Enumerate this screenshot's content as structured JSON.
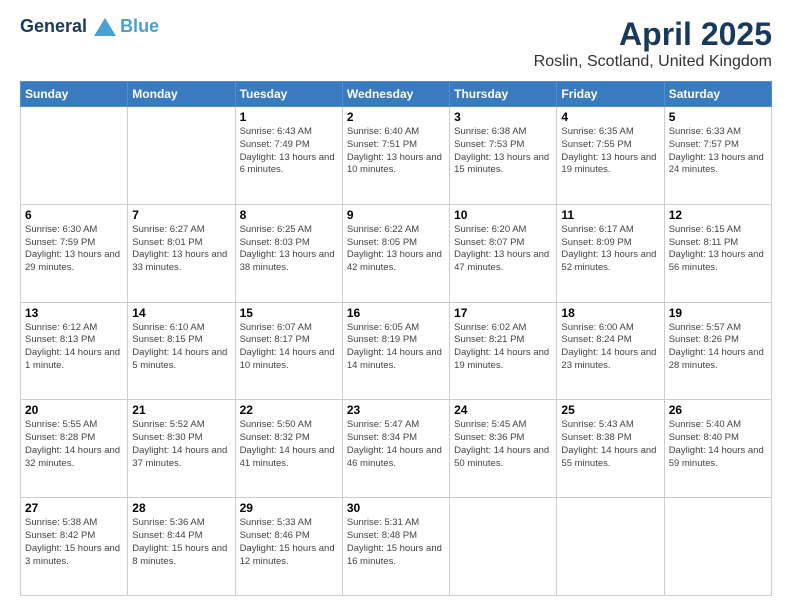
{
  "header": {
    "logo_line1": "General",
    "logo_line2": "Blue",
    "title": "April 2025",
    "subtitle": "Roslin, Scotland, United Kingdom"
  },
  "weekdays": [
    "Sunday",
    "Monday",
    "Tuesday",
    "Wednesday",
    "Thursday",
    "Friday",
    "Saturday"
  ],
  "weeks": [
    [
      {
        "day": "",
        "info": ""
      },
      {
        "day": "",
        "info": ""
      },
      {
        "day": "1",
        "info": "Sunrise: 6:43 AM\nSunset: 7:49 PM\nDaylight: 13 hours and 6 minutes."
      },
      {
        "day": "2",
        "info": "Sunrise: 6:40 AM\nSunset: 7:51 PM\nDaylight: 13 hours and 10 minutes."
      },
      {
        "day": "3",
        "info": "Sunrise: 6:38 AM\nSunset: 7:53 PM\nDaylight: 13 hours and 15 minutes."
      },
      {
        "day": "4",
        "info": "Sunrise: 6:35 AM\nSunset: 7:55 PM\nDaylight: 13 hours and 19 minutes."
      },
      {
        "day": "5",
        "info": "Sunrise: 6:33 AM\nSunset: 7:57 PM\nDaylight: 13 hours and 24 minutes."
      }
    ],
    [
      {
        "day": "6",
        "info": "Sunrise: 6:30 AM\nSunset: 7:59 PM\nDaylight: 13 hours and 29 minutes."
      },
      {
        "day": "7",
        "info": "Sunrise: 6:27 AM\nSunset: 8:01 PM\nDaylight: 13 hours and 33 minutes."
      },
      {
        "day": "8",
        "info": "Sunrise: 6:25 AM\nSunset: 8:03 PM\nDaylight: 13 hours and 38 minutes."
      },
      {
        "day": "9",
        "info": "Sunrise: 6:22 AM\nSunset: 8:05 PM\nDaylight: 13 hours and 42 minutes."
      },
      {
        "day": "10",
        "info": "Sunrise: 6:20 AM\nSunset: 8:07 PM\nDaylight: 13 hours and 47 minutes."
      },
      {
        "day": "11",
        "info": "Sunrise: 6:17 AM\nSunset: 8:09 PM\nDaylight: 13 hours and 52 minutes."
      },
      {
        "day": "12",
        "info": "Sunrise: 6:15 AM\nSunset: 8:11 PM\nDaylight: 13 hours and 56 minutes."
      }
    ],
    [
      {
        "day": "13",
        "info": "Sunrise: 6:12 AM\nSunset: 8:13 PM\nDaylight: 14 hours and 1 minute."
      },
      {
        "day": "14",
        "info": "Sunrise: 6:10 AM\nSunset: 8:15 PM\nDaylight: 14 hours and 5 minutes."
      },
      {
        "day": "15",
        "info": "Sunrise: 6:07 AM\nSunset: 8:17 PM\nDaylight: 14 hours and 10 minutes."
      },
      {
        "day": "16",
        "info": "Sunrise: 6:05 AM\nSunset: 8:19 PM\nDaylight: 14 hours and 14 minutes."
      },
      {
        "day": "17",
        "info": "Sunrise: 6:02 AM\nSunset: 8:21 PM\nDaylight: 14 hours and 19 minutes."
      },
      {
        "day": "18",
        "info": "Sunrise: 6:00 AM\nSunset: 8:24 PM\nDaylight: 14 hours and 23 minutes."
      },
      {
        "day": "19",
        "info": "Sunrise: 5:57 AM\nSunset: 8:26 PM\nDaylight: 14 hours and 28 minutes."
      }
    ],
    [
      {
        "day": "20",
        "info": "Sunrise: 5:55 AM\nSunset: 8:28 PM\nDaylight: 14 hours and 32 minutes."
      },
      {
        "day": "21",
        "info": "Sunrise: 5:52 AM\nSunset: 8:30 PM\nDaylight: 14 hours and 37 minutes."
      },
      {
        "day": "22",
        "info": "Sunrise: 5:50 AM\nSunset: 8:32 PM\nDaylight: 14 hours and 41 minutes."
      },
      {
        "day": "23",
        "info": "Sunrise: 5:47 AM\nSunset: 8:34 PM\nDaylight: 14 hours and 46 minutes."
      },
      {
        "day": "24",
        "info": "Sunrise: 5:45 AM\nSunset: 8:36 PM\nDaylight: 14 hours and 50 minutes."
      },
      {
        "day": "25",
        "info": "Sunrise: 5:43 AM\nSunset: 8:38 PM\nDaylight: 14 hours and 55 minutes."
      },
      {
        "day": "26",
        "info": "Sunrise: 5:40 AM\nSunset: 8:40 PM\nDaylight: 14 hours and 59 minutes."
      }
    ],
    [
      {
        "day": "27",
        "info": "Sunrise: 5:38 AM\nSunset: 8:42 PM\nDaylight: 15 hours and 3 minutes."
      },
      {
        "day": "28",
        "info": "Sunrise: 5:36 AM\nSunset: 8:44 PM\nDaylight: 15 hours and 8 minutes."
      },
      {
        "day": "29",
        "info": "Sunrise: 5:33 AM\nSunset: 8:46 PM\nDaylight: 15 hours and 12 minutes."
      },
      {
        "day": "30",
        "info": "Sunrise: 5:31 AM\nSunset: 8:48 PM\nDaylight: 15 hours and 16 minutes."
      },
      {
        "day": "",
        "info": ""
      },
      {
        "day": "",
        "info": ""
      },
      {
        "day": "",
        "info": ""
      }
    ]
  ]
}
